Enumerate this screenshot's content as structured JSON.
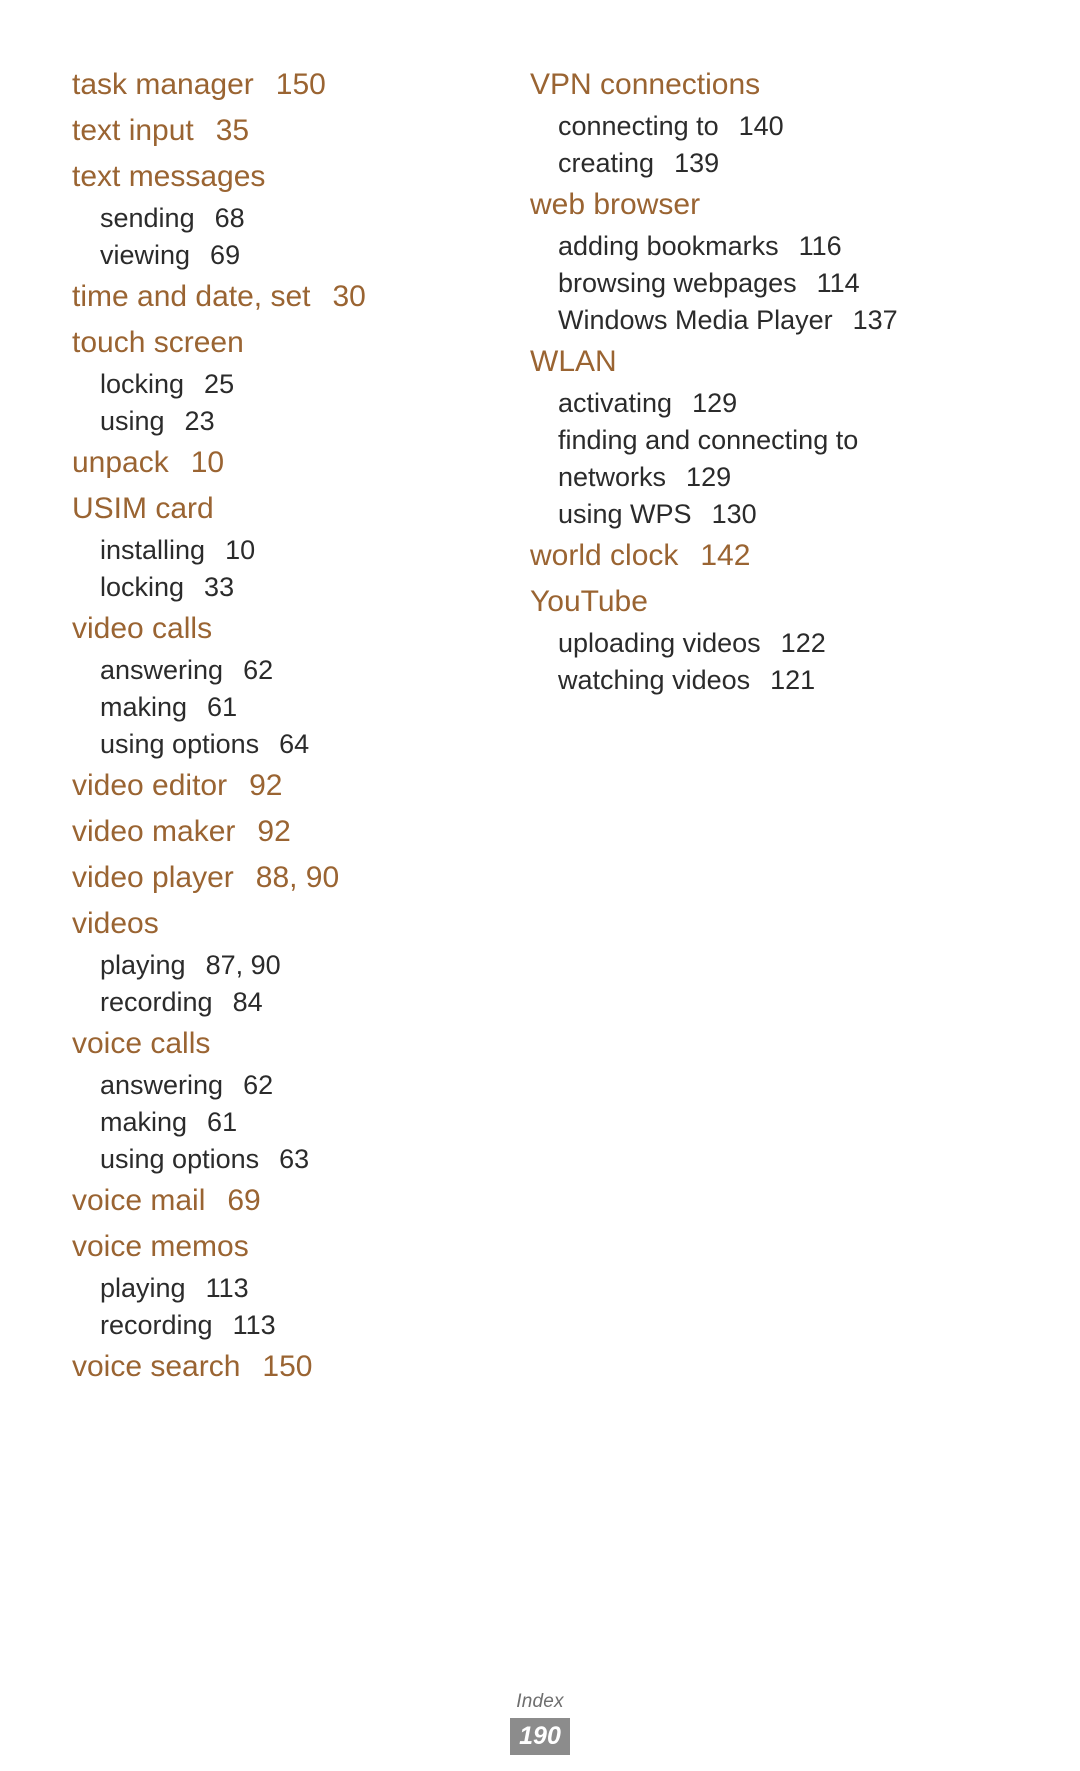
{
  "footer": {
    "section_label": "Index",
    "page_number": "190"
  },
  "colors": {
    "heading": "#9a6432",
    "body": "#2b2b2b",
    "page_badge_bg": "#8c8c8c",
    "page_badge_text": "#ffffff",
    "background": "#ffffff"
  },
  "columns": {
    "left": [
      {
        "term": "task manager",
        "pages": "150",
        "subs": []
      },
      {
        "term": "text input",
        "pages": "35",
        "subs": []
      },
      {
        "term": "text messages",
        "pages": "",
        "subs": [
          {
            "term": "sending",
            "pages": "68"
          },
          {
            "term": "viewing",
            "pages": "69"
          }
        ]
      },
      {
        "term": "time and date, set",
        "pages": "30",
        "subs": []
      },
      {
        "term": "touch screen",
        "pages": "",
        "subs": [
          {
            "term": "locking",
            "pages": "25"
          },
          {
            "term": "using",
            "pages": "23"
          }
        ]
      },
      {
        "term": "unpack",
        "pages": "10",
        "subs": []
      },
      {
        "term": "USIM card",
        "pages": "",
        "subs": [
          {
            "term": "installing",
            "pages": "10"
          },
          {
            "term": "locking",
            "pages": "33"
          }
        ]
      },
      {
        "term": "video calls",
        "pages": "",
        "subs": [
          {
            "term": "answering",
            "pages": "62"
          },
          {
            "term": "making",
            "pages": "61"
          },
          {
            "term": "using options",
            "pages": "64"
          }
        ]
      },
      {
        "term": "video editor",
        "pages": "92",
        "subs": []
      },
      {
        "term": "video maker",
        "pages": "92",
        "subs": []
      },
      {
        "term": "video player",
        "pages": "88, 90",
        "subs": []
      },
      {
        "term": "videos",
        "pages": "",
        "subs": [
          {
            "term": "playing",
            "pages": "87, 90"
          },
          {
            "term": "recording",
            "pages": "84"
          }
        ]
      },
      {
        "term": "voice calls",
        "pages": "",
        "subs": [
          {
            "term": "answering",
            "pages": "62"
          },
          {
            "term": "making",
            "pages": "61"
          },
          {
            "term": "using options",
            "pages": "63"
          }
        ]
      },
      {
        "term": "voice mail",
        "pages": "69",
        "subs": []
      },
      {
        "term": "voice memos",
        "pages": "",
        "subs": [
          {
            "term": "playing",
            "pages": "113"
          },
          {
            "term": "recording",
            "pages": "113"
          }
        ]
      },
      {
        "term": "voice search",
        "pages": "150",
        "subs": []
      }
    ],
    "right": [
      {
        "term": "VPN connections",
        "pages": "",
        "subs": [
          {
            "term": "connecting to",
            "pages": "140"
          },
          {
            "term": "creating",
            "pages": "139"
          }
        ]
      },
      {
        "term": "web browser",
        "pages": "",
        "subs": [
          {
            "term": "adding bookmarks",
            "pages": "116"
          },
          {
            "term": "browsing webpages",
            "pages": "114"
          },
          {
            "term": "Windows Media Player",
            "pages": "137"
          }
        ]
      },
      {
        "term": "WLAN",
        "pages": "",
        "subs": [
          {
            "term": "activating",
            "pages": "129"
          },
          {
            "term": "finding and connecting to networks",
            "pages": "129",
            "wrap": true
          },
          {
            "term": "using WPS",
            "pages": "130"
          }
        ]
      },
      {
        "term": "world clock",
        "pages": "142",
        "subs": []
      },
      {
        "term": "YouTube",
        "pages": "",
        "subs": [
          {
            "term": "uploading videos",
            "pages": "122"
          },
          {
            "term": "watching videos",
            "pages": "121"
          }
        ]
      }
    ]
  }
}
